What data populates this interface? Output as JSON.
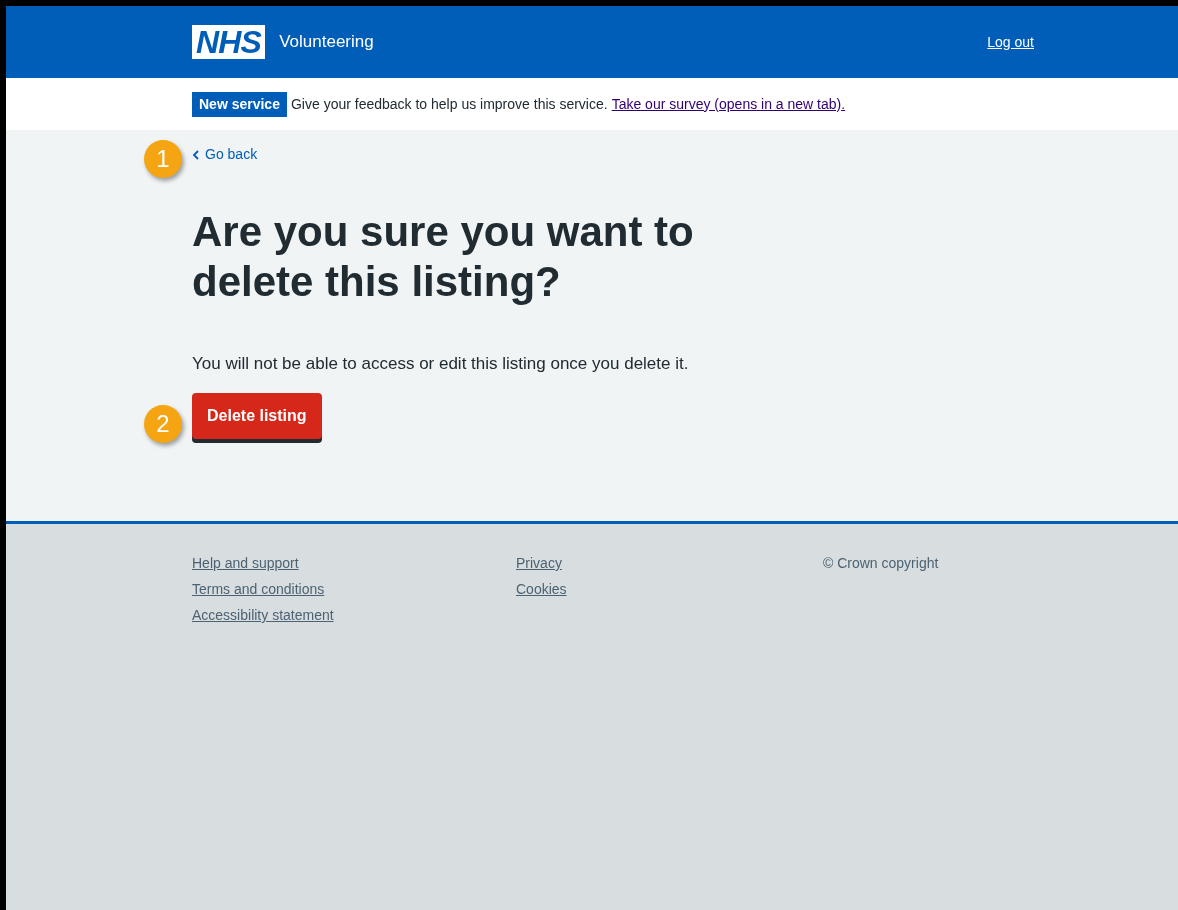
{
  "header": {
    "logo": "NHS",
    "service_name": "Volunteering",
    "log_out": "Log out"
  },
  "banner": {
    "tag": "New service",
    "text": "Give your feedback to help us improve this service.",
    "link": "Take our survey (opens in a new tab)."
  },
  "back_link": {
    "label": "Go back",
    "callout": "1"
  },
  "heading": "Are you sure you want to delete this listing?",
  "body": "You will not be able to access or edit this listing once you delete it.",
  "button": {
    "label": "Delete listing",
    "callout": "2"
  },
  "footer": {
    "columns": [
      [
        "Help and support",
        "Terms and conditions",
        "Accessibility statement"
      ],
      [
        "Privacy",
        "Cookies"
      ]
    ],
    "copyright": "© Crown copyright"
  }
}
